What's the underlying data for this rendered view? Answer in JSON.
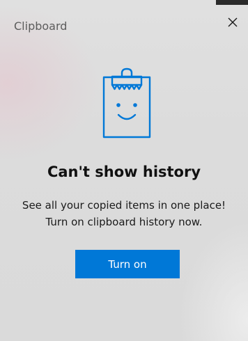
{
  "header": {
    "title": "Clipboard",
    "close_icon": "close-icon"
  },
  "illustration": {
    "icon": "clipboard-smile-icon",
    "color": "#0078d7"
  },
  "empty_state": {
    "heading": "Can't show history",
    "description_line1": "See all your copied items in one place!",
    "description_line2": "Turn on clipboard history now."
  },
  "actions": {
    "turn_on_label": "Turn on",
    "accent_color": "#0078d7"
  }
}
